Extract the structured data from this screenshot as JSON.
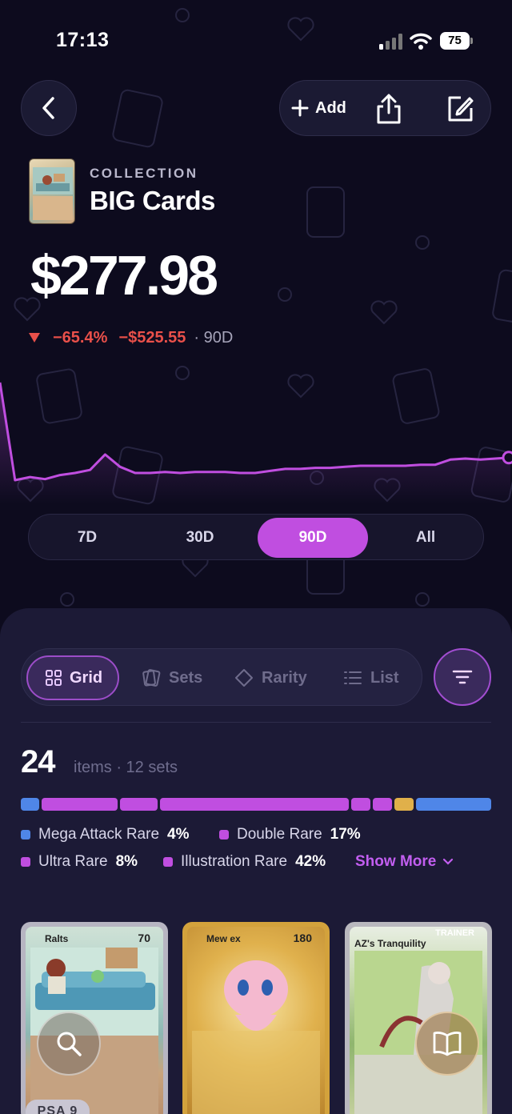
{
  "status_bar": {
    "time": "17:13",
    "battery": "75"
  },
  "header": {
    "add_label": "Add"
  },
  "collection": {
    "eyebrow": "COLLECTION",
    "title": "BIG Cards",
    "value": "$277.98",
    "change_pct": "−65.4%",
    "change_amount": "−$525.55",
    "period": "· 90D"
  },
  "chart_data": {
    "type": "line",
    "color": "#c04ee0",
    "values": [
      100,
      5,
      8,
      6,
      10,
      12,
      15,
      30,
      18,
      12,
      12,
      13,
      12,
      13,
      13,
      13,
      12,
      12,
      14,
      16,
      16,
      17,
      17,
      18,
      19,
      19,
      19,
      19,
      20,
      20,
      25,
      26,
      25,
      26,
      27
    ]
  },
  "range_tabs": [
    {
      "label": "7D",
      "active": false
    },
    {
      "label": "30D",
      "active": false
    },
    {
      "label": "90D",
      "active": true
    },
    {
      "label": "All",
      "active": false
    }
  ],
  "view_tabs": [
    {
      "label": "Grid",
      "icon": "grid-icon",
      "active": true
    },
    {
      "label": "Sets",
      "icon": "sets-icon",
      "active": false
    },
    {
      "label": "Rarity",
      "icon": "diamond-icon",
      "active": false
    },
    {
      "label": "List",
      "icon": "list-icon",
      "active": false
    }
  ],
  "summary": {
    "count": "24",
    "sub": "items · 12 sets"
  },
  "rarity_distribution": [
    {
      "name": "Mega Attack Rare",
      "pct": "4%",
      "color": "#4f86e8"
    },
    {
      "name": "Double Rare",
      "pct": "17%",
      "color": "#c04ee0"
    },
    {
      "name": "Ultra Rare",
      "pct": "8%",
      "color": "#c04ee0"
    },
    {
      "name": "Illustration Rare",
      "pct": "42%",
      "color": "#c04ee0"
    }
  ],
  "show_more": "Show More",
  "cards": [
    {
      "name": "Ralts",
      "hp": "70",
      "grade": "PSA 9",
      "action_icon": "search-icon"
    },
    {
      "name": "Mew ex",
      "hp": "180"
    },
    {
      "name": "AZ's Tranquility",
      "type": "TRAINER",
      "action_icon": "book-icon"
    }
  ]
}
